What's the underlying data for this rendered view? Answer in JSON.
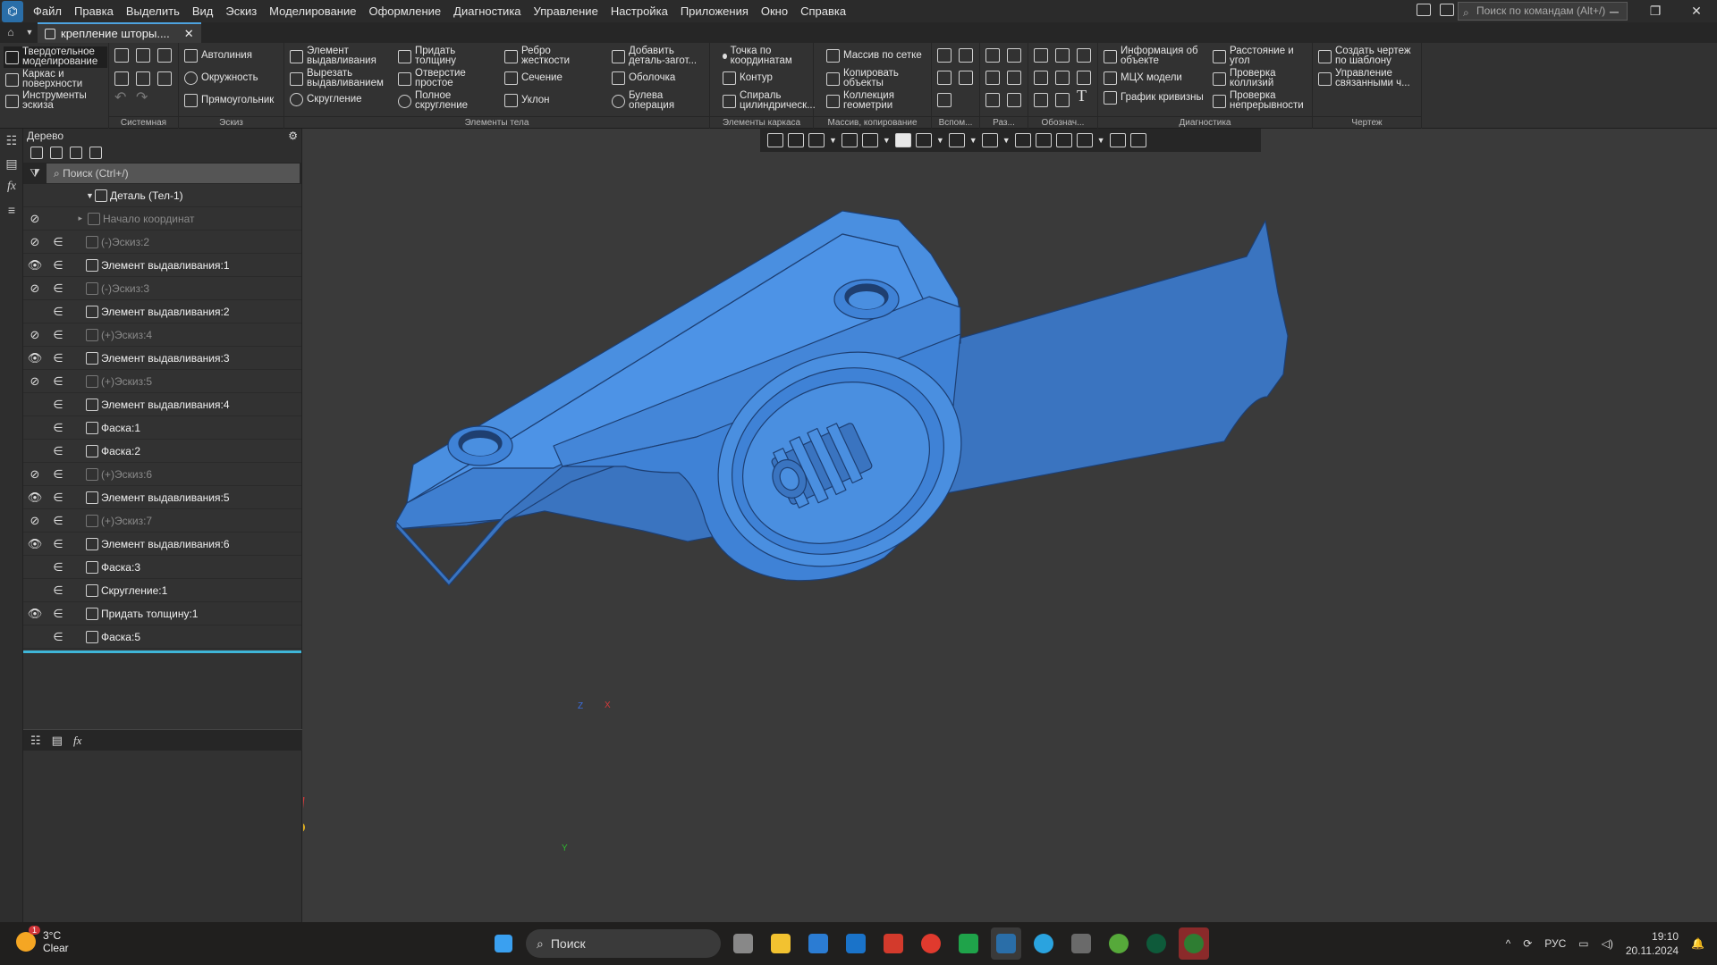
{
  "menu": [
    "Файл",
    "Правка",
    "Выделить",
    "Вид",
    "Эскиз",
    "Моделирование",
    "Оформление",
    "Диагностика",
    "Управление",
    "Настройка",
    "Приложения",
    "Окно",
    "Справка"
  ],
  "command_search_placeholder": "Поиск по командам (Alt+/)",
  "doc_tab": "крепление шторы....",
  "ribbon": {
    "modes": [
      "Твердотельное моделирование",
      "Каркас и поверхности",
      "Инструменты эскиза"
    ],
    "groups": {
      "system": "Системная",
      "sketch": "Эскиз",
      "body": "Элементы тела",
      "frame": "Элементы каркаса",
      "array": "Массив, копирование",
      "aux": "Вспом...",
      "dim": "Раз...",
      "marks": "Обознач...",
      "diag": "Диагностика",
      "drawing": "Чертеж"
    },
    "sketch_tools": [
      "Автолиния",
      "Окружность",
      "Прямоугольник"
    ],
    "body_tools": [
      "Элемент выдавливания",
      "Вырезать выдавливанием",
      "Скругление",
      "Придать толщину",
      "Отверстие простое",
      "Полное скругление",
      "Ребро жесткости",
      "Сечение",
      "Уклон",
      "Добавить деталь-загот...",
      "Оболочка",
      "Булева операция"
    ],
    "frame_tools": [
      "Точка по координатам",
      "Контур",
      "Спираль цилиндрическ..."
    ],
    "array_tools": [
      "Массив по сетке",
      "Копировать объекты",
      "Коллекция геометрии"
    ],
    "diag_tools": [
      "Информация об объекте",
      "МЦХ модели",
      "График кривизны",
      "Расстояние и угол",
      "Проверка коллизий",
      "Проверка непрерывности"
    ],
    "drawing_tools": [
      "Создать чертеж по шаблону",
      "Управление связанными ч..."
    ]
  },
  "tree": {
    "title": "Дерево",
    "search_placeholder": "Поиск (Ctrl+/)",
    "root": "Деталь (Тел-1)",
    "items": [
      {
        "label": "Начало координат",
        "vis": "hidden",
        "link": false,
        "dim": true,
        "kind": "origin"
      },
      {
        "label": "(-)Эскиз:2",
        "vis": "hidden",
        "link": true,
        "dim": true,
        "kind": "sketch"
      },
      {
        "label": "Элемент выдавливания:1",
        "vis": "shown",
        "link": true,
        "dim": false,
        "kind": "extrude"
      },
      {
        "label": "(-)Эскиз:3",
        "vis": "hidden",
        "link": true,
        "dim": true,
        "kind": "sketch"
      },
      {
        "label": "Элемент выдавливания:2",
        "vis": "none",
        "link": true,
        "dim": false,
        "kind": "extrude"
      },
      {
        "label": "(+)Эскиз:4",
        "vis": "hidden",
        "link": true,
        "dim": true,
        "kind": "sketch"
      },
      {
        "label": "Элемент выдавливания:3",
        "vis": "shown",
        "link": true,
        "dim": false,
        "kind": "extrude"
      },
      {
        "label": "(+)Эскиз:5",
        "vis": "hidden",
        "link": true,
        "dim": true,
        "kind": "sketch"
      },
      {
        "label": "Элемент выдавливания:4",
        "vis": "none",
        "link": true,
        "dim": false,
        "kind": "extrude"
      },
      {
        "label": "Фаска:1",
        "vis": "none",
        "link": true,
        "dim": false,
        "kind": "chamfer"
      },
      {
        "label": "Фаска:2",
        "vis": "none",
        "link": true,
        "dim": false,
        "kind": "chamfer"
      },
      {
        "label": "(+)Эскиз:6",
        "vis": "hidden",
        "link": true,
        "dim": true,
        "kind": "sketch"
      },
      {
        "label": "Элемент выдавливания:5",
        "vis": "shown",
        "link": true,
        "dim": false,
        "kind": "extrude"
      },
      {
        "label": "(+)Эскиз:7",
        "vis": "hidden",
        "link": true,
        "dim": true,
        "kind": "sketch"
      },
      {
        "label": "Элемент выдавливания:6",
        "vis": "shown",
        "link": true,
        "dim": false,
        "kind": "extrude"
      },
      {
        "label": "Фаска:3",
        "vis": "none",
        "link": true,
        "dim": false,
        "kind": "chamfer"
      },
      {
        "label": "Скругление:1",
        "vis": "none",
        "link": true,
        "dim": false,
        "kind": "fillet"
      },
      {
        "label": "Придать толщину:1",
        "vis": "shown",
        "link": true,
        "dim": false,
        "kind": "thicken"
      },
      {
        "label": "Фаска:5",
        "vis": "none",
        "link": true,
        "dim": false,
        "kind": "chamfer"
      }
    ]
  },
  "axes": {
    "x": "X",
    "y": "Y",
    "z": "Z"
  },
  "colors": {
    "model": "#4a8fe0",
    "model_dark": "#3a74c0",
    "accent": "#3fb6d8"
  },
  "taskbar": {
    "weather_temp": "3°C",
    "weather_text": "Clear",
    "weather_badge": "1",
    "search": "Поиск",
    "lang": "РУС",
    "time": "19:10",
    "date": "20.11.2024"
  }
}
